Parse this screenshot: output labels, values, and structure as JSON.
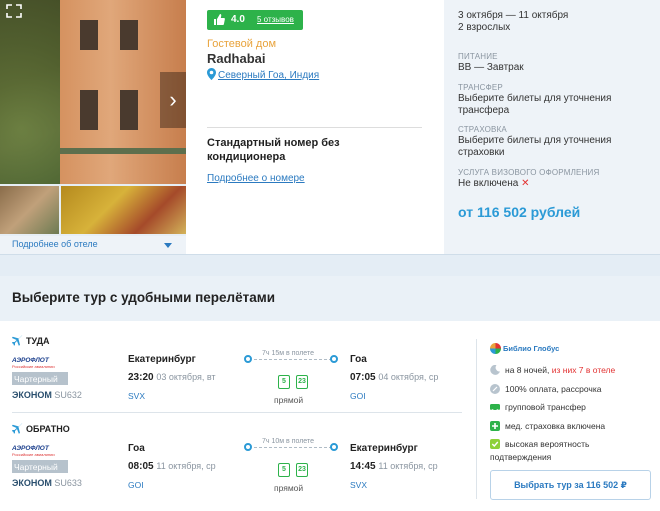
{
  "gallery": {
    "more_hotel_label": "Подробнее об отеле"
  },
  "hotel": {
    "rating": "4.0",
    "reviews": "5 отзывов",
    "type": "Гостевой дом",
    "name": "Radhabai",
    "location": "Северный Гоа, Индия",
    "room_name": "Стандартный номер без кондиционера",
    "room_more": "Подробнее о номере"
  },
  "summary": {
    "dates": "3 октября — 11 октября",
    "pax": "2 взрослых",
    "meal_label": "ПИТАНИЕ",
    "meal_value": "BB — Завтрак",
    "transfer_label": "ТРАНСФЕР",
    "transfer_value": "Выберите билеты для уточнения трансфера",
    "insurance_label": "СТРАХОВКА",
    "insurance_value": "Выберите билеты для уточнения страховки",
    "visa_label": "УСЛУГА ВИЗОВОГО ОФОРМЛЕНИЯ",
    "visa_value": "Не включена",
    "price": "от 116 502 рублей"
  },
  "section_title": "Выберите тур с удобными перелётами",
  "flights": {
    "outbound": {
      "direction": "ТУДА",
      "airline": "АЭРОФЛОТ",
      "airline_sub": "Российские авиалинии",
      "charter": "Чартерный",
      "class": "ЭКОНОМ",
      "flight_no": "SU632",
      "dep_city": "Екатеринбург",
      "dep_time": "23:20",
      "dep_date": "03 октября, вт",
      "dep_code": "SVX",
      "duration": "7ч 15м в полете",
      "bag1": "5",
      "bag2": "23",
      "direct": "прямой",
      "arr_city": "Гоа",
      "arr_time": "07:05",
      "arr_date": "04 октября, ср",
      "arr_code": "GOI"
    },
    "inbound": {
      "direction": "ОБРАТНО",
      "airline": "АЭРОФЛОТ",
      "airline_sub": "Российские авиалинии",
      "charter": "Чартерный",
      "class": "ЭКОНОМ",
      "flight_no": "SU633",
      "dep_city": "Гоа",
      "dep_time": "08:05",
      "dep_date": "11 октября, ср",
      "dep_code": "GOI",
      "duration": "7ч 10м в полете",
      "bag1": "5",
      "bag2": "23",
      "direct": "прямой",
      "arr_city": "Екатеринбург",
      "arr_time": "14:45",
      "arr_date": "11 октября, ср",
      "arr_code": "SVX"
    }
  },
  "operator": {
    "name": "Библио Глобус",
    "nights": "на 8 ночей,",
    "nights_hotel": "из них 7 в отеле",
    "payment": "100% оплата, рассрочка",
    "transfer": "групповой трансфер",
    "insurance": "мед. страховка включена",
    "confirm": "высокая вероятность подтверждения",
    "select_button": "Выбрать тур за 116 502 ₽"
  },
  "colors": {
    "accent": "#2b9ad6",
    "link": "#2b7ac0",
    "rating_green": "#2db24a",
    "hotel_type": "#e8a33c",
    "summary_bg": "#eef3f8"
  }
}
